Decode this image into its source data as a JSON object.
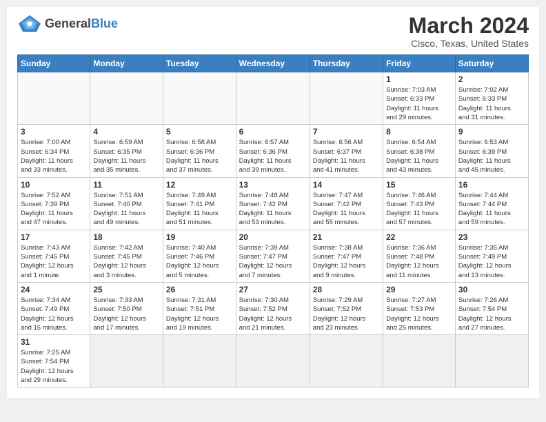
{
  "logo": {
    "text_general": "General",
    "text_blue": "Blue"
  },
  "title": {
    "month_year": "March 2024",
    "location": "Cisco, Texas, United States"
  },
  "weekdays": [
    "Sunday",
    "Monday",
    "Tuesday",
    "Wednesday",
    "Thursday",
    "Friday",
    "Saturday"
  ],
  "weeks": [
    [
      {
        "day": "",
        "info": ""
      },
      {
        "day": "",
        "info": ""
      },
      {
        "day": "",
        "info": ""
      },
      {
        "day": "",
        "info": ""
      },
      {
        "day": "",
        "info": ""
      },
      {
        "day": "1",
        "info": "Sunrise: 7:03 AM\nSunset: 6:33 PM\nDaylight: 11 hours\nand 29 minutes."
      },
      {
        "day": "2",
        "info": "Sunrise: 7:02 AM\nSunset: 6:33 PM\nDaylight: 11 hours\nand 31 minutes."
      }
    ],
    [
      {
        "day": "3",
        "info": "Sunrise: 7:00 AM\nSunset: 6:34 PM\nDaylight: 11 hours\nand 33 minutes."
      },
      {
        "day": "4",
        "info": "Sunrise: 6:59 AM\nSunset: 6:35 PM\nDaylight: 11 hours\nand 35 minutes."
      },
      {
        "day": "5",
        "info": "Sunrise: 6:58 AM\nSunset: 6:36 PM\nDaylight: 11 hours\nand 37 minutes."
      },
      {
        "day": "6",
        "info": "Sunrise: 6:57 AM\nSunset: 6:36 PM\nDaylight: 11 hours\nand 39 minutes."
      },
      {
        "day": "7",
        "info": "Sunrise: 6:56 AM\nSunset: 6:37 PM\nDaylight: 11 hours\nand 41 minutes."
      },
      {
        "day": "8",
        "info": "Sunrise: 6:54 AM\nSunset: 6:38 PM\nDaylight: 11 hours\nand 43 minutes."
      },
      {
        "day": "9",
        "info": "Sunrise: 6:53 AM\nSunset: 6:39 PM\nDaylight: 11 hours\nand 45 minutes."
      }
    ],
    [
      {
        "day": "10",
        "info": "Sunrise: 7:52 AM\nSunset: 7:39 PM\nDaylight: 11 hours\nand 47 minutes."
      },
      {
        "day": "11",
        "info": "Sunrise: 7:51 AM\nSunset: 7:40 PM\nDaylight: 11 hours\nand 49 minutes."
      },
      {
        "day": "12",
        "info": "Sunrise: 7:49 AM\nSunset: 7:41 PM\nDaylight: 11 hours\nand 51 minutes."
      },
      {
        "day": "13",
        "info": "Sunrise: 7:48 AM\nSunset: 7:42 PM\nDaylight: 11 hours\nand 53 minutes."
      },
      {
        "day": "14",
        "info": "Sunrise: 7:47 AM\nSunset: 7:42 PM\nDaylight: 11 hours\nand 55 minutes."
      },
      {
        "day": "15",
        "info": "Sunrise: 7:46 AM\nSunset: 7:43 PM\nDaylight: 11 hours\nand 57 minutes."
      },
      {
        "day": "16",
        "info": "Sunrise: 7:44 AM\nSunset: 7:44 PM\nDaylight: 11 hours\nand 59 minutes."
      }
    ],
    [
      {
        "day": "17",
        "info": "Sunrise: 7:43 AM\nSunset: 7:45 PM\nDaylight: 12 hours\nand 1 minute."
      },
      {
        "day": "18",
        "info": "Sunrise: 7:42 AM\nSunset: 7:45 PM\nDaylight: 12 hours\nand 3 minutes."
      },
      {
        "day": "19",
        "info": "Sunrise: 7:40 AM\nSunset: 7:46 PM\nDaylight: 12 hours\nand 5 minutes."
      },
      {
        "day": "20",
        "info": "Sunrise: 7:39 AM\nSunset: 7:47 PM\nDaylight: 12 hours\nand 7 minutes."
      },
      {
        "day": "21",
        "info": "Sunrise: 7:38 AM\nSunset: 7:47 PM\nDaylight: 12 hours\nand 9 minutes."
      },
      {
        "day": "22",
        "info": "Sunrise: 7:36 AM\nSunset: 7:48 PM\nDaylight: 12 hours\nand 11 minutes."
      },
      {
        "day": "23",
        "info": "Sunrise: 7:35 AM\nSunset: 7:49 PM\nDaylight: 12 hours\nand 13 minutes."
      }
    ],
    [
      {
        "day": "24",
        "info": "Sunrise: 7:34 AM\nSunset: 7:49 PM\nDaylight: 12 hours\nand 15 minutes."
      },
      {
        "day": "25",
        "info": "Sunrise: 7:33 AM\nSunset: 7:50 PM\nDaylight: 12 hours\nand 17 minutes."
      },
      {
        "day": "26",
        "info": "Sunrise: 7:31 AM\nSunset: 7:51 PM\nDaylight: 12 hours\nand 19 minutes."
      },
      {
        "day": "27",
        "info": "Sunrise: 7:30 AM\nSunset: 7:52 PM\nDaylight: 12 hours\nand 21 minutes."
      },
      {
        "day": "28",
        "info": "Sunrise: 7:29 AM\nSunset: 7:52 PM\nDaylight: 12 hours\nand 23 minutes."
      },
      {
        "day": "29",
        "info": "Sunrise: 7:27 AM\nSunset: 7:53 PM\nDaylight: 12 hours\nand 25 minutes."
      },
      {
        "day": "30",
        "info": "Sunrise: 7:26 AM\nSunset: 7:54 PM\nDaylight: 12 hours\nand 27 minutes."
      }
    ],
    [
      {
        "day": "31",
        "info": "Sunrise: 7:25 AM\nSunset: 7:54 PM\nDaylight: 12 hours\nand 29 minutes."
      },
      {
        "day": "",
        "info": ""
      },
      {
        "day": "",
        "info": ""
      },
      {
        "day": "",
        "info": ""
      },
      {
        "day": "",
        "info": ""
      },
      {
        "day": "",
        "info": ""
      },
      {
        "day": "",
        "info": ""
      }
    ]
  ]
}
